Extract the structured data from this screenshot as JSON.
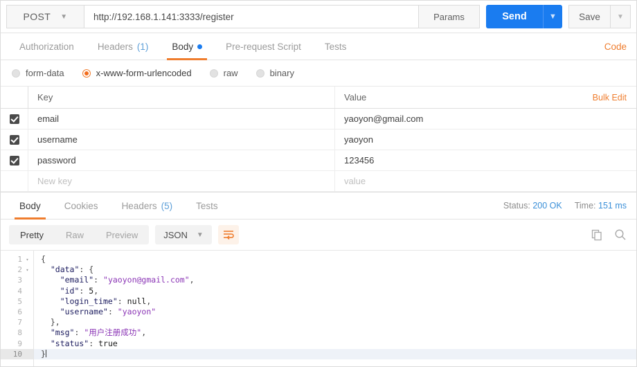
{
  "request": {
    "method": "POST",
    "url": "http://192.168.1.141:3333/register",
    "params_label": "Params",
    "send_label": "Send",
    "save_label": "Save",
    "tabs": [
      {
        "label": "Authorization",
        "count": "",
        "active": false,
        "dot": false
      },
      {
        "label": "Headers",
        "count": "(1)",
        "active": false,
        "dot": false
      },
      {
        "label": "Body",
        "count": "",
        "active": true,
        "dot": true
      },
      {
        "label": "Pre-request Script",
        "count": "",
        "active": false,
        "dot": false
      },
      {
        "label": "Tests",
        "count": "",
        "active": false,
        "dot": false
      }
    ],
    "code_link": "Code",
    "body_types": [
      {
        "label": "form-data",
        "selected": false
      },
      {
        "label": "x-www-form-urlencoded",
        "selected": true
      },
      {
        "label": "raw",
        "selected": false
      },
      {
        "label": "binary",
        "selected": false
      }
    ],
    "table": {
      "header_key": "Key",
      "header_value": "Value",
      "bulk_edit": "Bulk Edit",
      "new_key_placeholder": "New key",
      "new_value_placeholder": "value",
      "rows": [
        {
          "checked": true,
          "key": "email",
          "value": "yaoyon@gmail.com"
        },
        {
          "checked": true,
          "key": "username",
          "value": "yaoyon"
        },
        {
          "checked": true,
          "key": "password",
          "value": "123456"
        }
      ]
    }
  },
  "response": {
    "tabs": [
      {
        "label": "Body",
        "count": "",
        "active": true
      },
      {
        "label": "Cookies",
        "count": "",
        "active": false
      },
      {
        "label": "Headers",
        "count": "(5)",
        "active": false
      },
      {
        "label": "Tests",
        "count": "",
        "active": false
      }
    ],
    "status_label": "Status:",
    "status_value": "200 OK",
    "time_label": "Time:",
    "time_value": "151 ms",
    "view_modes": [
      {
        "label": "Pretty",
        "active": true
      },
      {
        "label": "Raw",
        "active": false
      },
      {
        "label": "Preview",
        "active": false
      }
    ],
    "format": "JSON",
    "body_lines": [
      {
        "n": "1",
        "fold": true,
        "active": false,
        "tokens": [
          {
            "t": "{",
            "c": "tok-punc"
          }
        ]
      },
      {
        "n": "2",
        "fold": true,
        "active": false,
        "tokens": [
          {
            "t": "  \"data\"",
            "c": "tok-key"
          },
          {
            "t": ": {",
            "c": "tok-punc"
          }
        ]
      },
      {
        "n": "3",
        "fold": false,
        "active": false,
        "tokens": [
          {
            "t": "    \"email\"",
            "c": "tok-key"
          },
          {
            "t": ": ",
            "c": "tok-punc"
          },
          {
            "t": "\"yaoyon@gmail.com\"",
            "c": "tok-str"
          },
          {
            "t": ",",
            "c": "tok-punc"
          }
        ]
      },
      {
        "n": "4",
        "fold": false,
        "active": false,
        "tokens": [
          {
            "t": "    \"id\"",
            "c": "tok-key"
          },
          {
            "t": ": ",
            "c": "tok-punc"
          },
          {
            "t": "5",
            "c": "tok-num"
          },
          {
            "t": ",",
            "c": "tok-punc"
          }
        ]
      },
      {
        "n": "5",
        "fold": false,
        "active": false,
        "tokens": [
          {
            "t": "    \"login_time\"",
            "c": "tok-key"
          },
          {
            "t": ": ",
            "c": "tok-punc"
          },
          {
            "t": "null",
            "c": "tok-kw"
          },
          {
            "t": ",",
            "c": "tok-punc"
          }
        ]
      },
      {
        "n": "6",
        "fold": false,
        "active": false,
        "tokens": [
          {
            "t": "    \"username\"",
            "c": "tok-key"
          },
          {
            "t": ": ",
            "c": "tok-punc"
          },
          {
            "t": "\"yaoyon\"",
            "c": "tok-str"
          }
        ]
      },
      {
        "n": "7",
        "fold": false,
        "active": false,
        "tokens": [
          {
            "t": "  },",
            "c": "tok-punc"
          }
        ]
      },
      {
        "n": "8",
        "fold": false,
        "active": false,
        "tokens": [
          {
            "t": "  \"msg\"",
            "c": "tok-key"
          },
          {
            "t": ": ",
            "c": "tok-punc"
          },
          {
            "t": "\"用户注册成功\"",
            "c": "tok-str"
          },
          {
            "t": ",",
            "c": "tok-punc"
          }
        ]
      },
      {
        "n": "9",
        "fold": false,
        "active": false,
        "tokens": [
          {
            "t": "  \"status\"",
            "c": "tok-key"
          },
          {
            "t": ": ",
            "c": "tok-punc"
          },
          {
            "t": "true",
            "c": "tok-kw"
          }
        ]
      },
      {
        "n": "10",
        "fold": false,
        "active": true,
        "tokens": [
          {
            "t": "}",
            "c": "tok-punc"
          }
        ]
      }
    ]
  },
  "icons": {
    "method_caret": "chevron-down-icon",
    "send_caret": "chevron-down-icon",
    "save_caret": "chevron-down-icon",
    "format_caret": "chevron-down-icon",
    "wrap": "wrap-lines-icon",
    "copy": "copy-icon",
    "search": "search-icon"
  },
  "colors": {
    "accent_orange": "#ef7d2e",
    "send_blue": "#1a7cf0",
    "status_blue": "#3a8fd8",
    "string_purple": "#8a34b5"
  }
}
